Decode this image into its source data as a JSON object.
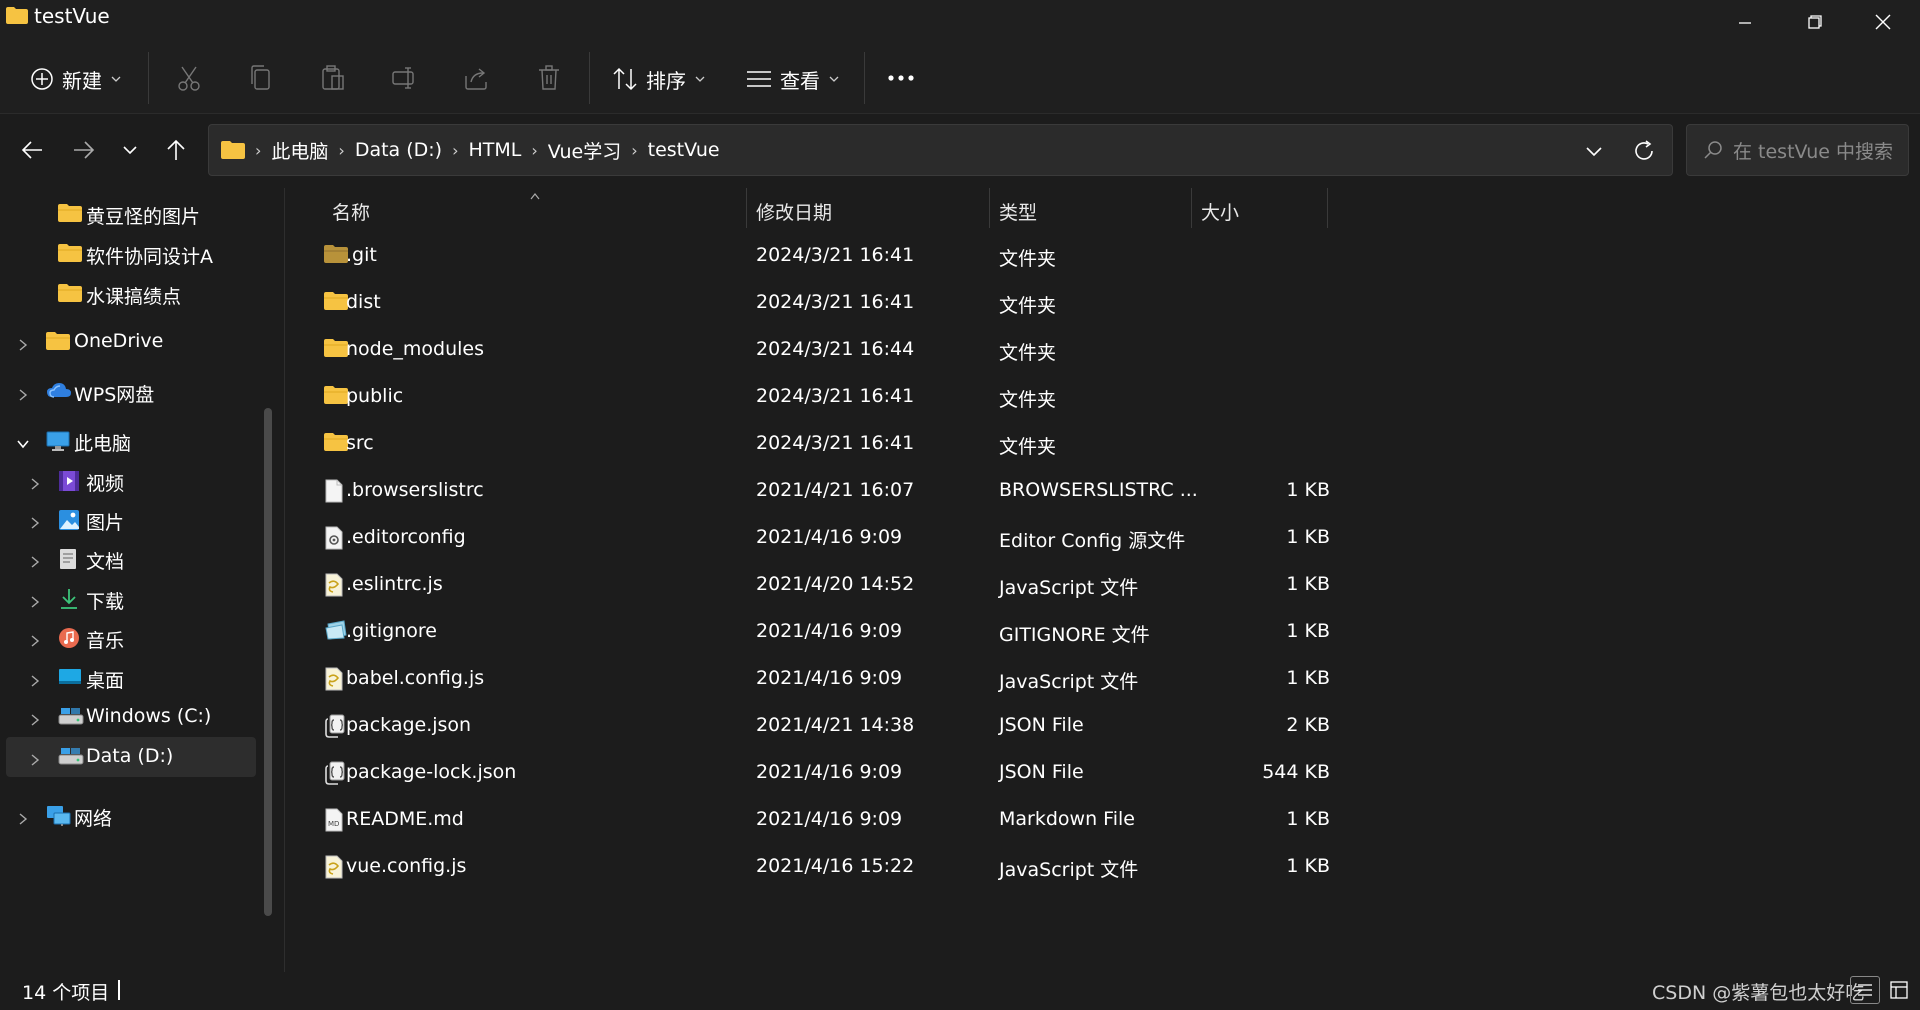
{
  "window": {
    "title": "testVue"
  },
  "toolbar": {
    "new_label": "新建",
    "sort_label": "排序",
    "view_label": "查看",
    "icons": [
      "cut-icon",
      "copy-icon",
      "paste-icon",
      "rename-icon",
      "share-icon",
      "delete-icon"
    ]
  },
  "address": {
    "crumbs": [
      "此电脑",
      "Data (D:)",
      "HTML",
      "Vue学习",
      "testVue"
    ]
  },
  "search": {
    "placeholder": "在 testVue 中搜索"
  },
  "sidebar": {
    "items": [
      {
        "label": "黄豆怪的图片",
        "icon": "folder"
      },
      {
        "label": "软件协同设计A",
        "icon": "folder"
      },
      {
        "label": "水课搞绩点",
        "icon": "folder"
      },
      {
        "label": "OneDrive",
        "icon": "folder"
      },
      {
        "label": "WPS网盘",
        "icon": "cloud"
      },
      {
        "label": "此电脑",
        "icon": "pc"
      },
      {
        "label": "视频",
        "icon": "video"
      },
      {
        "label": "图片",
        "icon": "pictures"
      },
      {
        "label": "文档",
        "icon": "documents"
      },
      {
        "label": "下载",
        "icon": "download"
      },
      {
        "label": "音乐",
        "icon": "music"
      },
      {
        "label": "桌面",
        "icon": "desktop"
      },
      {
        "label": "Windows (C:)",
        "icon": "drive"
      },
      {
        "label": "Data (D:)",
        "icon": "drive"
      },
      {
        "label": "网络",
        "icon": "network"
      }
    ]
  },
  "columns": {
    "name": "名称",
    "date": "修改日期",
    "type": "类型",
    "size": "大小"
  },
  "files": [
    {
      "name": ".git",
      "date": "2024/3/21 16:41",
      "type": "文件夹",
      "size": "",
      "icon": "folder-dark"
    },
    {
      "name": "dist",
      "date": "2024/3/21 16:41",
      "type": "文件夹",
      "size": "",
      "icon": "folder"
    },
    {
      "name": "node_modules",
      "date": "2024/3/21 16:44",
      "type": "文件夹",
      "size": "",
      "icon": "folder"
    },
    {
      "name": "public",
      "date": "2024/3/21 16:41",
      "type": "文件夹",
      "size": "",
      "icon": "folder"
    },
    {
      "name": "src",
      "date": "2024/3/21 16:41",
      "type": "文件夹",
      "size": "",
      "icon": "folder"
    },
    {
      "name": ".browserslistrc",
      "date": "2021/4/21 16:07",
      "type": "BROWSERSLISTRC ...",
      "size": "1 KB",
      "icon": "file"
    },
    {
      "name": ".editorconfig",
      "date": "2021/4/16 9:09",
      "type": "Editor Config 源文件",
      "size": "1 KB",
      "icon": "config-file"
    },
    {
      "name": ".eslintrc.js",
      "date": "2021/4/20 14:52",
      "type": "JavaScript 文件",
      "size": "1 KB",
      "icon": "js-file"
    },
    {
      "name": ".gitignore",
      "date": "2021/4/16 9:09",
      "type": "GITIGNORE 文件",
      "size": "1 KB",
      "icon": "gitignore-file"
    },
    {
      "name": "babel.config.js",
      "date": "2021/4/16 9:09",
      "type": "JavaScript 文件",
      "size": "1 KB",
      "icon": "js-file"
    },
    {
      "name": "package.json",
      "date": "2021/4/21 14:38",
      "type": "JSON File",
      "size": "2 KB",
      "icon": "json-file"
    },
    {
      "name": "package-lock.json",
      "date": "2021/4/16 9:09",
      "type": "JSON File",
      "size": "544 KB",
      "icon": "json-file"
    },
    {
      "name": "README.md",
      "date": "2021/4/16 9:09",
      "type": "Markdown File",
      "size": "1 KB",
      "icon": "md-file"
    },
    {
      "name": "vue.config.js",
      "date": "2021/4/16 15:22",
      "type": "JavaScript 文件",
      "size": "1 KB",
      "icon": "js-file"
    }
  ],
  "status": {
    "count": "14 个项目"
  },
  "watermark": "CSDN @紫薯包也太好吃",
  "colors": {
    "folder": "#f6c342",
    "folder_dark": "#b8923a",
    "background": "#1c1c1c",
    "selected": "#2d2d2d"
  }
}
